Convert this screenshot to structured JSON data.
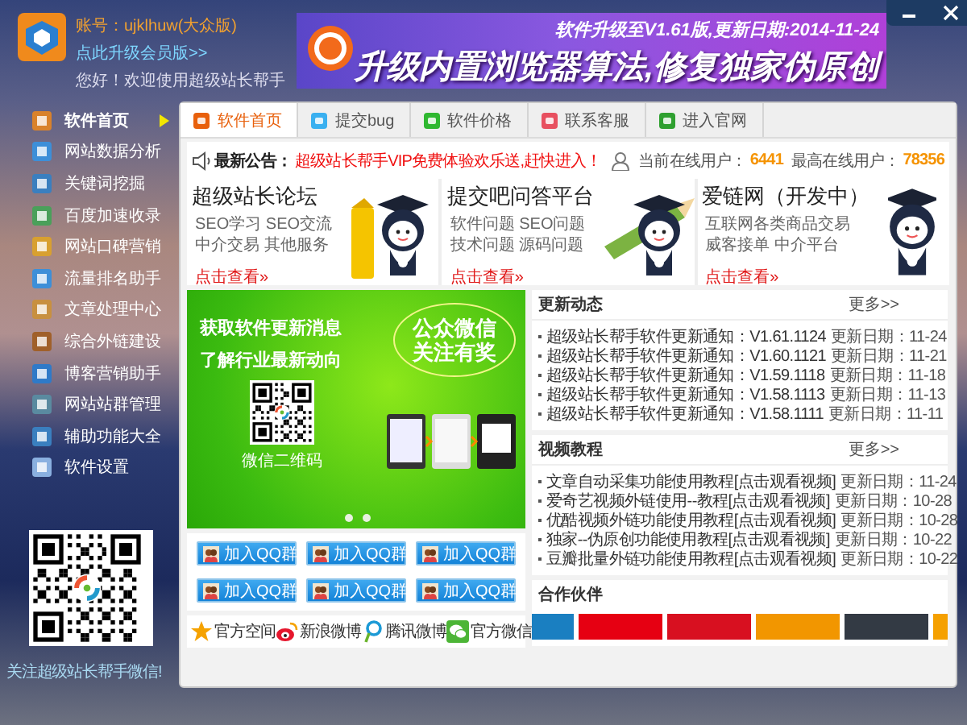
{
  "account": {
    "label": "账号：ujklhuw(大众版)",
    "upgrade_link": "点此升级会员版>>",
    "greeting": "您好！欢迎使用超级站长帮手"
  },
  "banner": {
    "subtitle": "软件升级至V1.61版,更新日期:2014-11-24",
    "headline": "升级内置浏览器算法,修复独家伪原创"
  },
  "sidebar": {
    "items": [
      {
        "label": "软件首页",
        "selected": true
      },
      {
        "label": "网站数据分析",
        "selected": false
      },
      {
        "label": "关键词挖掘",
        "selected": false
      },
      {
        "label": "百度加速收录",
        "selected": false
      },
      {
        "label": "网站口碑营销",
        "selected": false
      },
      {
        "label": "流量排名助手",
        "selected": false
      },
      {
        "label": "文章处理中心",
        "selected": false
      },
      {
        "label": "综合外链建设",
        "selected": false
      },
      {
        "label": "博客营销助手",
        "selected": false
      },
      {
        "label": "网站站群管理",
        "selected": false
      },
      {
        "label": "辅助功能大全",
        "selected": false
      },
      {
        "label": "软件设置",
        "selected": false
      }
    ],
    "qr_caption": "关注超级站长帮手微信!"
  },
  "tabs": [
    {
      "label": "软件首页",
      "selected": true
    },
    {
      "label": "提交bug",
      "selected": false
    },
    {
      "label": "软件价格",
      "selected": false
    },
    {
      "label": "联系客服",
      "selected": false
    },
    {
      "label": "进入官网",
      "selected": false
    }
  ],
  "notice": {
    "label": "最新公告：",
    "text": "超级站长帮手VIP免费体验欢乐送,赶快进入！"
  },
  "online": {
    "current_label": "当前在线用户：",
    "current": "6441",
    "peak_label": "最高在线用户：",
    "peak": "78356"
  },
  "cards": [
    {
      "title": "超级站长论坛",
      "lines": [
        "SEO学习 SEO交流",
        "中介交易 其他服务"
      ],
      "link": "点击查看»"
    },
    {
      "title": "提交吧问答平台",
      "lines": [
        "软件问题 SEO问题",
        "技术问题 源码问题"
      ],
      "link": "点击查看»"
    },
    {
      "title": "爱链网（开发中）",
      "lines": [
        "互联网各类商品交易",
        "威客接单 中介平台"
      ],
      "link": "点击查看»"
    }
  ],
  "promo": {
    "lines": [
      "获取软件更新消息",
      "了解行业最新动向"
    ],
    "bubble": [
      "公众微信",
      "关注有奖"
    ],
    "qr_caption": "微信二维码"
  },
  "qq_buttons": [
    "加入QQ群",
    "加入QQ群",
    "加入QQ群",
    "加入QQ群",
    "加入QQ群",
    "加入QQ群"
  ],
  "social_links": [
    {
      "label": "官方空间",
      "kind": "qzone"
    },
    {
      "label": "新浪微博",
      "kind": "weibo"
    },
    {
      "label": "腾讯微博",
      "kind": "tencent"
    },
    {
      "label": "官方微信",
      "kind": "wechat"
    }
  ],
  "updates": {
    "title": "更新动态",
    "more": "更多>>",
    "rows": [
      {
        "text": "超级站长帮手软件更新通知：V1.61.1124",
        "date": "更新日期：11-24"
      },
      {
        "text": "超级站长帮手软件更新通知：V1.60.1121",
        "date": "更新日期：11-21"
      },
      {
        "text": "超级站长帮手软件更新通知：V1.59.1118",
        "date": "更新日期：11-18"
      },
      {
        "text": "超级站长帮手软件更新通知：V1.58.1113",
        "date": "更新日期：11-13"
      },
      {
        "text": "超级站长帮手软件更新通知：V1.58.1111",
        "date": "更新日期：11-11"
      }
    ]
  },
  "videos": {
    "title": "视频教程",
    "more": "更多>>",
    "rows": [
      {
        "text": "文章自动采集功能使用教程[点击观看视频]",
        "date": "更新日期：11-24"
      },
      {
        "text": "爱奇艺视频外链使用--教程[点击观看视频]",
        "date": "更新日期：10-28"
      },
      {
        "text": "优酷视频外链功能使用教程[点击观看视频]",
        "date": "更新日期：10-28"
      },
      {
        "text": "独家--伪原创功能使用教程[点击观看视频]",
        "date": "更新日期：10-22"
      },
      {
        "text": "豆瓣批量外链功能使用教程[点击观看视频]",
        "date": "更新日期：10-22"
      }
    ]
  },
  "partners": {
    "title": "合作伙伴"
  }
}
